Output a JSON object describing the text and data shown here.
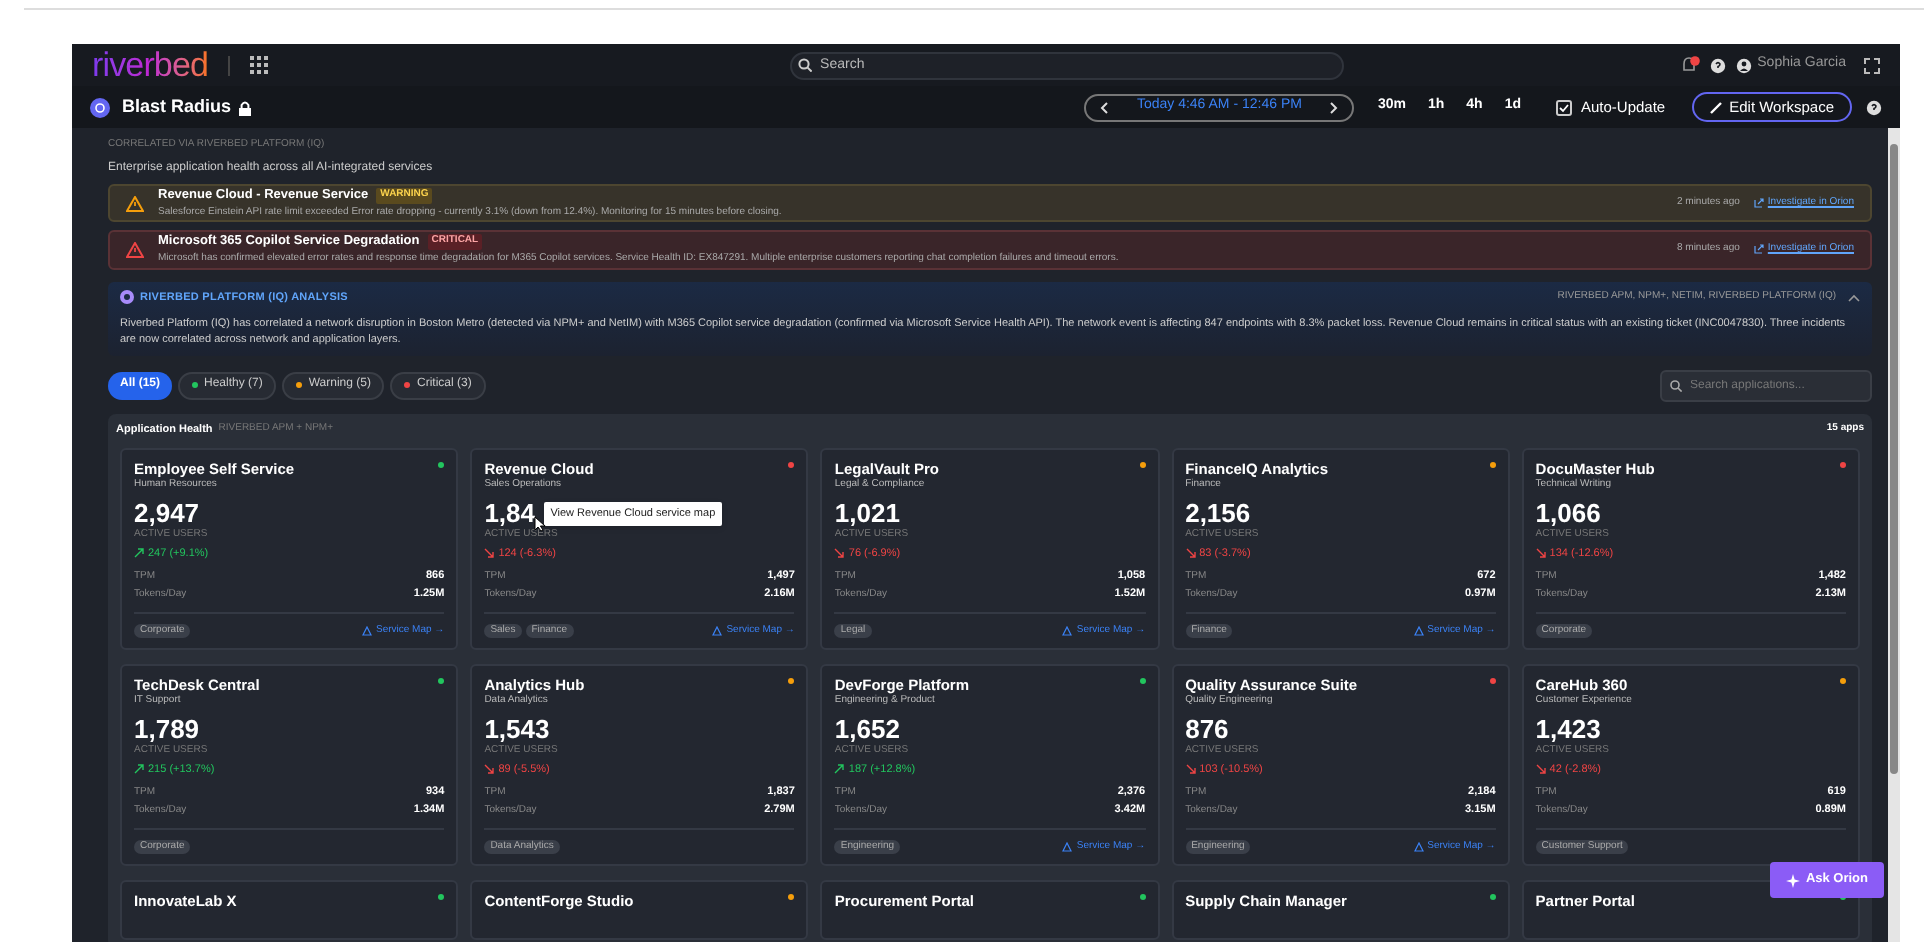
{
  "header": {
    "logo": "riverbed",
    "search": {
      "placeholder": "Search"
    },
    "user": "Sophia Garcia"
  },
  "workspace": {
    "title": "Blast Radius",
    "time_range": "Today 4:46 AM - 12:46 PM",
    "ranges": [
      {
        "label": "30m",
        "selected": false
      },
      {
        "label": "1h",
        "selected": false
      },
      {
        "label": "4h",
        "selected": false
      },
      {
        "label": "1d",
        "selected": false
      }
    ],
    "auto_update": {
      "label": "Auto-Update",
      "checked": true
    },
    "edit_button": "Edit Workspace"
  },
  "overview": {
    "eyebrow": "CORRELATED VIA RIVERBED PLATFORM (IQ)",
    "subtitle": "Enterprise application health across all AI-integrated services"
  },
  "alerts": [
    {
      "kind": "warning",
      "title": "Revenue Cloud - Revenue Service",
      "badge": "WARNING",
      "message": "Salesforce Einstein API rate limit exceeded Error rate dropping - currently 3.1% (down from 12.4%). Monitoring for 15 minutes before closing.",
      "time": "2 minutes ago",
      "link": "Investigate in Orion"
    },
    {
      "kind": "critical",
      "title": "Microsoft 365 Copilot Service Degradation",
      "badge": "CRITICAL",
      "message": "Microsoft has confirmed elevated error rates and response time degradation for M365 Copilot services. Service Health ID: EX847291. Multiple enterprise customers reporting chat completion failures and timeout errors.",
      "time": "8 minutes ago",
      "link": "Investigate in Orion"
    }
  ],
  "analysis": {
    "title": "RIVERBED PLATFORM (IQ) ANALYSIS",
    "sources": "RIVERBED APM, NPM+, NETIM, RIVERBED PLATFORM (IQ)",
    "expanded": true,
    "text": "Riverbed Platform (IQ) has correlated a network disruption in Boston Metro (detected via NPM+ and NetIM) with M365 Copilot service degradation (confirmed via Microsoft Service Health API). The network event is affecting 847 endpoints with 8.3% packet loss. Revenue Cloud remains in critical status with an existing ticket (INC0047830). Three incidents are now correlated across network and application layers."
  },
  "filters": [
    {
      "label": "All (15)",
      "selected": true
    },
    {
      "label": "Healthy (7)",
      "selected": false,
      "color": "#22c55e"
    },
    {
      "label": "Warning (5)",
      "selected": false,
      "color": "#f59e0b"
    },
    {
      "label": "Critical (3)",
      "selected": false,
      "color": "#ef4444"
    }
  ],
  "app_search": {
    "placeholder": "Search applications..."
  },
  "application_health": {
    "title": "Application Health",
    "source": "RIVERBED APM + NPM+",
    "count": "15 apps",
    "apps": [
      {
        "name": "Employee Self Service",
        "department": "Human Resources",
        "color": "#22c55e",
        "active_users": "2,947",
        "users_label": "ACTIVE USERS",
        "kind": "increase",
        "change": "247 (+9.1%)",
        "tpm_label": "TPM",
        "tpm": "866",
        "tokens_label": "Tokens/Day",
        "tokens": "1.25M",
        "tags": [
          "Corporate"
        ],
        "service_map": "Service Map →"
      },
      {
        "name": "Revenue Cloud",
        "department": "Sales Operations",
        "color": "#ef4444",
        "active_users": "1,84",
        "users_label": "ACTIVE USERS",
        "kind": "decrease",
        "change": "124 (-6.3%)",
        "tpm_label": "TPM",
        "tpm": "1,497",
        "tokens_label": "Tokens/Day",
        "tokens": "2.16M",
        "tags": [
          "Sales",
          "Finance"
        ],
        "service_map": "Service Map →",
        "tooltip": "View Revenue Cloud service map"
      },
      {
        "name": "LegalVault Pro",
        "department": "Legal & Compliance",
        "color": "#f59e0b",
        "active_users": "1,021",
        "users_label": "ACTIVE USERS",
        "kind": "decrease",
        "change": "76 (-6.9%)",
        "tpm_label": "TPM",
        "tpm": "1,058",
        "tokens_label": "Tokens/Day",
        "tokens": "1.52M",
        "tags": [
          "Legal"
        ],
        "service_map": "Service Map →"
      },
      {
        "name": "FinanceIQ Analytics",
        "department": "Finance",
        "color": "#f59e0b",
        "active_users": "2,156",
        "users_label": "ACTIVE USERS",
        "kind": "decrease",
        "change": "83 (-3.7%)",
        "tpm_label": "TPM",
        "tpm": "672",
        "tokens_label": "Tokens/Day",
        "tokens": "0.97M",
        "tags": [
          "Finance"
        ],
        "service_map": "Service Map →"
      },
      {
        "name": "DocuMaster Hub",
        "department": "Technical Writing",
        "color": "#ef4444",
        "active_users": "1,066",
        "users_label": "ACTIVE USERS",
        "kind": "decrease",
        "change": "134 (-12.6%)",
        "tpm_label": "TPM",
        "tpm": "1,482",
        "tokens_label": "Tokens/Day",
        "tokens": "2.13M",
        "tags": [
          "Corporate"
        ]
      },
      {
        "name": "TechDesk Central",
        "department": "IT Support",
        "color": "#22c55e",
        "active_users": "1,789",
        "users_label": "ACTIVE USERS",
        "kind": "increase",
        "change": "215 (+13.7%)",
        "tpm_label": "TPM",
        "tpm": "934",
        "tokens_label": "Tokens/Day",
        "tokens": "1.34M",
        "tags": [
          "Corporate"
        ]
      },
      {
        "name": "Analytics Hub",
        "department": "Data Analytics",
        "color": "#f59e0b",
        "active_users": "1,543",
        "users_label": "ACTIVE USERS",
        "kind": "decrease",
        "change": "89 (-5.5%)",
        "tpm_label": "TPM",
        "tpm": "1,837",
        "tokens_label": "Tokens/Day",
        "tokens": "2.79M",
        "tags": [
          "Data Analytics"
        ]
      },
      {
        "name": "DevForge Platform",
        "department": "Engineering & Product",
        "color": "#22c55e",
        "active_users": "1,652",
        "users_label": "ACTIVE USERS",
        "kind": "increase",
        "change": "187 (+12.8%)",
        "tpm_label": "TPM",
        "tpm": "2,376",
        "tokens_label": "Tokens/Day",
        "tokens": "3.42M",
        "tags": [
          "Engineering"
        ],
        "service_map": "Service Map →"
      },
      {
        "name": "Quality Assurance Suite",
        "department": "Quality Engineering",
        "color": "#ef4444",
        "active_users": "876",
        "users_label": "ACTIVE USERS",
        "kind": "decrease",
        "change": "103 (-10.5%)",
        "tpm_label": "TPM",
        "tpm": "2,184",
        "tokens_label": "Tokens/Day",
        "tokens": "3.15M",
        "tags": [
          "Engineering"
        ],
        "service_map": "Service Map →"
      },
      {
        "name": "CareHub 360",
        "department": "Customer Experience",
        "color": "#f59e0b",
        "active_users": "1,423",
        "users_label": "ACTIVE USERS",
        "kind": "decrease",
        "change": "42 (-2.8%)",
        "tpm_label": "TPM",
        "tpm": "619",
        "tokens_label": "Tokens/Day",
        "tokens": "0.89M",
        "tags": [
          "Customer Support"
        ]
      },
      {
        "name": "InnovateLab X",
        "color": "#22c55e"
      },
      {
        "name": "ContentForge Studio",
        "color": "#f59e0b"
      },
      {
        "name": "Procurement Portal",
        "color": "#22c55e"
      },
      {
        "name": "Supply Chain Manager",
        "color": "#22c55e"
      },
      {
        "name": "Partner Portal",
        "color": "#22c55e"
      }
    ]
  },
  "ask_button": "Ask Orion"
}
